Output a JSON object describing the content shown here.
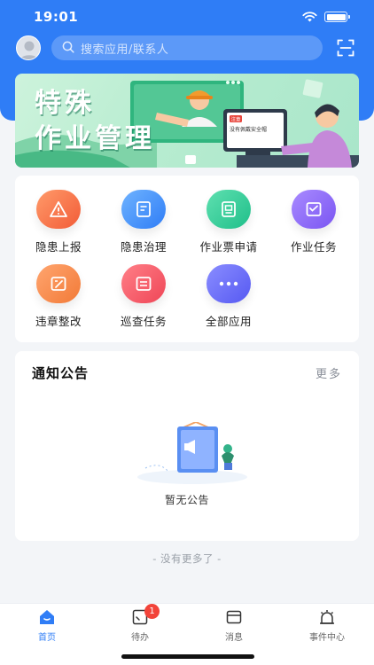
{
  "status_bar": {
    "time": "19:01"
  },
  "search": {
    "placeholder": "搜索应用/联系人"
  },
  "banner": {
    "title": "特殊\n作业管理",
    "tag": "注意",
    "screen_text": "没有佩戴安全帽"
  },
  "apps": [
    {
      "label": "隐患上报",
      "icon": "hazard-report-icon",
      "color_from": "#ff9a6a",
      "color_to": "#f25c37"
    },
    {
      "label": "隐患治理",
      "icon": "hazard-governance-icon",
      "color_from": "#6fb3ff",
      "color_to": "#2f7df6"
    },
    {
      "label": "作业票申请",
      "icon": "work-ticket-icon",
      "color_from": "#5fe0b0",
      "color_to": "#1fbf8a"
    },
    {
      "label": "作业任务",
      "icon": "work-task-icon",
      "color_from": "#a98bff",
      "color_to": "#7a55f2"
    },
    {
      "label": "违章整改",
      "icon": "violation-rectify-icon",
      "color_from": "#ffa56f",
      "color_to": "#f27a37"
    },
    {
      "label": "巡查任务",
      "icon": "patrol-task-icon",
      "color_from": "#ff7f87",
      "color_to": "#ef4657"
    },
    {
      "label": "全部应用",
      "icon": "more-apps-icon",
      "color_from": "#8a8dff",
      "color_to": "#5659f2"
    }
  ],
  "notice": {
    "title": "通知公告",
    "more": "更多",
    "empty_text": "暂无公告"
  },
  "footer_hint": "- 没有更多了 -",
  "tabbar": [
    {
      "label": "首页",
      "icon": "home-icon",
      "active": true
    },
    {
      "label": "待办",
      "icon": "todo-icon",
      "badge": "1"
    },
    {
      "label": "消息",
      "icon": "message-icon"
    },
    {
      "label": "事件中心",
      "icon": "alarm-icon"
    }
  ],
  "colors": {
    "primary": "#2f7df6",
    "badge": "#f2443a",
    "background": "#f3f5f8"
  }
}
